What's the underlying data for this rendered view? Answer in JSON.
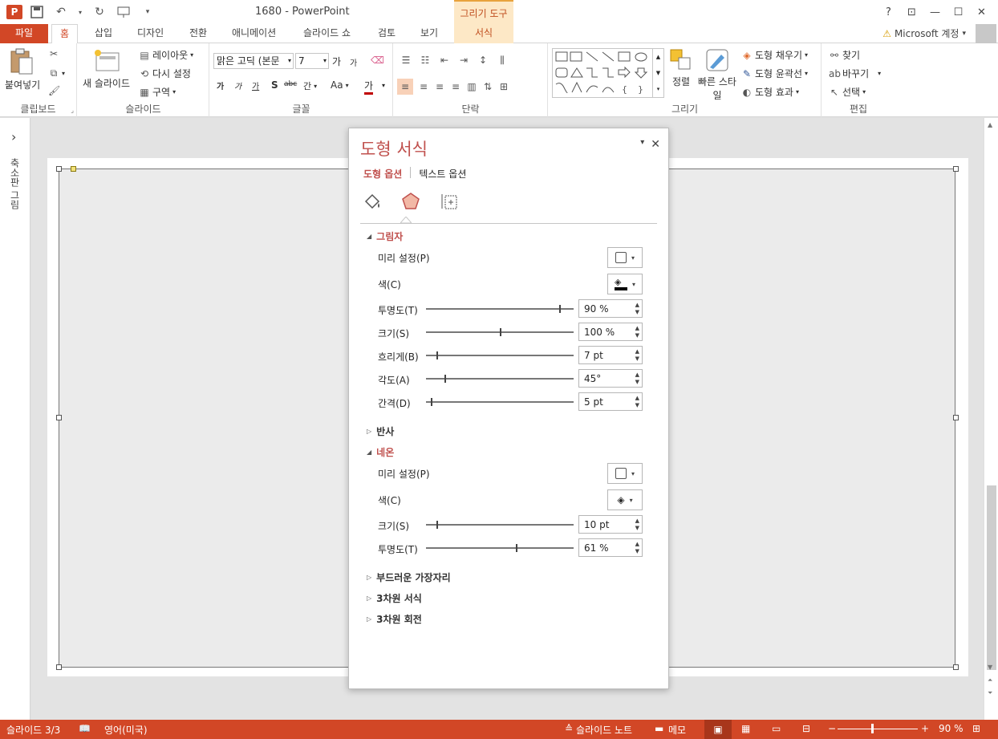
{
  "titlebar": {
    "app_icon": "P",
    "title": "1680 - PowerPoint",
    "context_tab": "그리기 도구",
    "help": "?",
    "ribbon_display": "⊡",
    "minimize": "—",
    "maximize": "☐",
    "close": "✕"
  },
  "tabs": {
    "file": "파일",
    "home": "홈",
    "insert": "삽입",
    "design": "디자인",
    "transitions": "전환",
    "animations": "애니메이션",
    "slideshow": "슬라이드 쇼",
    "review": "검토",
    "view": "보기",
    "format": "서식"
  },
  "account": {
    "warning": "⚠",
    "label": "Microsoft 계정",
    "arrow": "▾"
  },
  "ribbon": {
    "clipboard": {
      "paste": "붙여넣기",
      "group": "클립보드"
    },
    "slides": {
      "new_slide": "새 슬라이드",
      "layout": "레이아웃",
      "reset": "다시 설정",
      "section": "구역",
      "group": "슬라이드"
    },
    "font": {
      "font_name": "맑은 고딕 (본문",
      "font_size": "7",
      "bold": "가",
      "italic": "가",
      "underline": "가",
      "shadow": "S",
      "strike": "abc",
      "spacing": "간",
      "case": "Aa",
      "color": "가",
      "grow": "가",
      "shrink": "가",
      "group": "글꼴"
    },
    "paragraph": {
      "group": "단락"
    },
    "drawing": {
      "arrange": "정렬",
      "quick_styles": "빠른 스타일",
      "fill": "도형 채우기",
      "outline": "도형 윤곽선",
      "effects": "도형 효과",
      "group": "그리기"
    },
    "editing": {
      "find": "찾기",
      "replace": "바꾸기",
      "select": "선택",
      "group": "편집"
    }
  },
  "left_pane": {
    "expand": "›",
    "label": "축소판 그림"
  },
  "format_pane": {
    "title": "도형 서식",
    "tab_shape": "도형 옵션",
    "tab_text": "텍스트 옵션",
    "sections": {
      "shadow": "그림자",
      "reflection": "반사",
      "glow": "네온",
      "soft_edges": "부드러운 가장자리",
      "format_3d": "3차원 서식",
      "rotation_3d": "3차원 회전"
    },
    "shadow": {
      "preset_label": "미리 설정(P)",
      "color_label": "색(C)",
      "transparency_label": "투명도(T)",
      "transparency_value": "90 %",
      "transparency_pos": 0.9,
      "size_label": "크기(S)",
      "size_value": "100 %",
      "size_pos": 0.5,
      "blur_label": "흐리게(B)",
      "blur_value": "7 pt",
      "blur_pos": 0.07,
      "angle_label": "각도(A)",
      "angle_value": "45°",
      "angle_pos": 0.125,
      "distance_label": "간격(D)",
      "distance_value": "5 pt",
      "distance_pos": 0.03
    },
    "glow": {
      "preset_label": "미리 설정(P)",
      "color_label": "색(C)",
      "size_label": "크기(S)",
      "size_value": "10 pt",
      "size_pos": 0.07,
      "transparency_label": "투명도(T)",
      "transparency_value": "61 %",
      "transparency_pos": 0.61
    }
  },
  "statusbar": {
    "slide": "슬라이드 3/3",
    "language": "영어(미국)",
    "notes": "슬라이드 노트",
    "comments": "메모",
    "zoom_minus": "−",
    "zoom_plus": "+",
    "zoom": "90 %"
  },
  "colors": {
    "accent": "#d24726",
    "pane_title": "#c0504d",
    "context_tab_bg": "#fde8c6"
  }
}
